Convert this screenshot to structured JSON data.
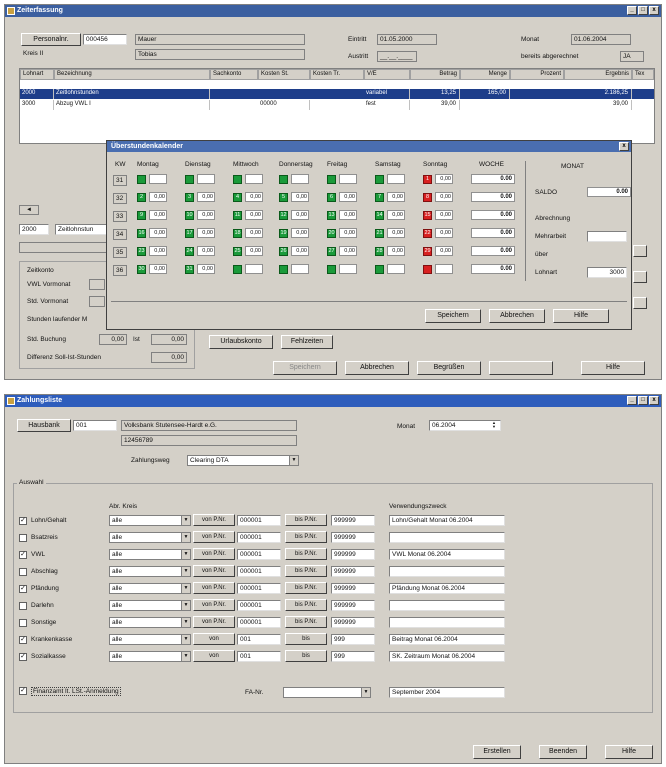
{
  "win1": {
    "title": "Zeiterfassung",
    "personal_btn": "Personalnr.",
    "personal_no": "000456",
    "name_last": "Mauer",
    "kreis_lbl": "Kreis II",
    "name_first": "Tobias",
    "eintritt_lbl": "Eintritt",
    "eintritt_val": "01.05.2000",
    "austritt_lbl": "Austritt",
    "austritt_val": "__.__.____",
    "monat_lbl": "Monat",
    "monat_val": "01.06.2004",
    "abgerechnet_lbl": "bereits abgerechnet",
    "abgerechnet_val": "JA",
    "grid_headers": [
      "Lohnart",
      "Bezeichnung",
      "Sachkonto",
      "Kosten St.",
      "Kosten Tr.",
      "V/E",
      "Betrag",
      "Menge",
      "Prozent",
      "Ergebnis",
      "Tex"
    ],
    "rows": [
      {
        "lohnart": "2000",
        "bez": "Zeitlohnstunden",
        "sach": "",
        "kst": "",
        "ktr": "",
        "ve": "variabel",
        "betrag": "13,25",
        "menge": "165,00",
        "prozent": "",
        "ergebnis": "2.186,25"
      },
      {
        "lohnart": "3000",
        "bez": "Abzug VWL I",
        "sach": "",
        "kst": "00000",
        "ktr": "",
        "ve": "fest",
        "betrag": "39,00",
        "menge": "",
        "prozent": "",
        "ergebnis": "39,00"
      }
    ],
    "lower_lohnart": "2000",
    "lower_bez": "Zeitlohnstun",
    "zeitkonto_lbl": "Zeitkonto",
    "vwl_vormonat_lbl": "VWL Vormonat",
    "std_vormonat_lbl": "Std. Vormonat",
    "stunden_lbl": "Stunden laufender M",
    "std_buchung_lbl": "Std. Buchung",
    "std_buchung_val": "0,00",
    "ist_lbl": "Ist",
    "ist_val": "0,00",
    "differenz_lbl": "Differenz Soll-Ist-Stunden",
    "differenz_val": "0,00",
    "urlaubskonto_btn": "Urlaubskonto",
    "fehlzeiten_btn": "Fehlzeiten",
    "speichern_btn": "Speichern",
    "abbrechen_btn": "Abbrechen",
    "begruessen_btn": "Begrüßen",
    "hilfe_btn": "Hilfe"
  },
  "calendar": {
    "title": "Überstundenkalender",
    "headers": [
      "KW",
      "Montag",
      "Dienstag",
      "Mittwoch",
      "Donnerstag",
      "Freitag",
      "Samstag",
      "Sonntag",
      "WOCHE"
    ],
    "monat_hdr": "MONAT",
    "weeks": [
      {
        "kw": "31",
        "days": [
          "",
          "",
          "",
          "",
          "",
          "",
          "1"
        ],
        "vals": [
          "",
          "",
          "",
          "",
          "",
          "",
          "0,00"
        ],
        "woche": "0.00"
      },
      {
        "kw": "32",
        "days": [
          "2",
          "3",
          "4",
          "5",
          "6",
          "7",
          "8"
        ],
        "vals": [
          "0,00",
          "0,00",
          "0,00",
          "0,00",
          "0,00",
          "0,00",
          "0,00"
        ],
        "woche": "0.00"
      },
      {
        "kw": "33",
        "days": [
          "9",
          "10",
          "11",
          "12",
          "13",
          "14",
          "15"
        ],
        "vals": [
          "0,00",
          "0,00",
          "0,00",
          "0,00",
          "0,00",
          "0,00",
          "0,00"
        ],
        "woche": "0.00"
      },
      {
        "kw": "34",
        "days": [
          "16",
          "17",
          "18",
          "19",
          "20",
          "21",
          "22"
        ],
        "vals": [
          "0,00",
          "0,00",
          "0,00",
          "0,00",
          "0,00",
          "0,00",
          "0,00"
        ],
        "woche": "0.00"
      },
      {
        "kw": "35",
        "days": [
          "23",
          "24",
          "25",
          "26",
          "27",
          "28",
          "29"
        ],
        "vals": [
          "0,00",
          "0,00",
          "0,00",
          "0,00",
          "0,00",
          "0,00",
          "0,00"
        ],
        "woche": "0.00"
      },
      {
        "kw": "36",
        "days": [
          "30",
          "31",
          "",
          "",
          "",
          "",
          ""
        ],
        "vals": [
          "0,00",
          "0,00",
          "",
          "",
          "",
          "",
          ""
        ],
        "woche": "0.00"
      }
    ],
    "saldo_lbl": "SALDO",
    "saldo_val": "0.00",
    "abrechnung_lbl": "Abrechnung",
    "mehrarbeit_lbl": "Mehrarbeit",
    "mehrarbeit_val": "",
    "ueber_lbl": "über",
    "lohnart_lbl": "Lohnart",
    "lohnart_val": "3000",
    "speichern_btn": "Speichern",
    "abbrechen_btn": "Abbrechen",
    "hilfe_btn": "Hilfe"
  },
  "win2": {
    "title": "Zahlungsliste",
    "hausbank_btn": "Hausbank",
    "hausbank_no": "001",
    "bank_name": "Volksbank Stutensee-Hardt e.G.",
    "blz": "12456789",
    "zahlungsweg_lbl": "Zahlungsweg",
    "zahlungsweg_val": "Clearing DTA",
    "monat_lbl": "Monat",
    "monat_val": "06.2004",
    "auswahl_lbl": "Auswahl",
    "abr_kreis_lbl": "Abr. Kreis",
    "verwendungszweck_lbl": "Verwendungszweck",
    "rows": [
      {
        "label": "Lohn/Gehalt",
        "checked": true,
        "kreis": "alle",
        "von": "von P.Nr.",
        "von_val": "000001",
        "bis": "bis P.Nr.",
        "bis_val": "999999",
        "zweck": "Lohn/Gehalt Monat 06.2004"
      },
      {
        "label": "Bsatzreis",
        "checked": false,
        "kreis": "alle",
        "von": "von P.Nr.",
        "von_val": "000001",
        "bis": "bis P.Nr.",
        "bis_val": "999999",
        "zweck": ""
      },
      {
        "label": "VWL",
        "checked": true,
        "kreis": "alle",
        "von": "von P.Nr.",
        "von_val": "000001",
        "bis": "bis P.Nr.",
        "bis_val": "999999",
        "zweck": "VWL Monat 06.2004"
      },
      {
        "label": "Abschlag",
        "checked": false,
        "kreis": "alle",
        "von": "von P.Nr.",
        "von_val": "000001",
        "bis": "bis P.Nr.",
        "bis_val": "999999",
        "zweck": ""
      },
      {
        "label": "Pfändung",
        "checked": true,
        "kreis": "alle",
        "von": "von P.Nr.",
        "von_val": "000001",
        "bis": "bis P.Nr.",
        "bis_val": "999999",
        "zweck": "Pfändung Monat 06.2004"
      },
      {
        "label": "Darlehn",
        "checked": false,
        "kreis": "alle",
        "von": "von P.Nr.",
        "von_val": "000001",
        "bis": "bis P.Nr.",
        "bis_val": "999999",
        "zweck": ""
      },
      {
        "label": "Sonstige",
        "checked": false,
        "kreis": "alle",
        "von": "von P.Nr.",
        "von_val": "000001",
        "bis": "bis P.Nr.",
        "bis_val": "999999",
        "zweck": ""
      },
      {
        "label": "Krankenkasse",
        "checked": true,
        "kreis": "alle",
        "von": "von",
        "von_val": "001",
        "bis": "bis",
        "bis_val": "999",
        "zweck": "Beitrag Monat 06.2004"
      },
      {
        "label": "Sozialkasse",
        "checked": true,
        "kreis": "alle",
        "von": "von",
        "von_val": "001",
        "bis": "bis",
        "bis_val": "999",
        "zweck": "SK. Zeitraum Monat 06.2004"
      }
    ],
    "finanzamt_lbl": "Finanzamt lt. LSt.-Anmeldung",
    "finanzamt_checked": true,
    "fanr_lbl": "FA-Nr.",
    "fanr_val": "",
    "finanzamt_zweck": "September 2004",
    "erstellen_btn": "Erstellen",
    "beenden_btn": "Beenden",
    "hilfe_btn": "Hilfe"
  }
}
